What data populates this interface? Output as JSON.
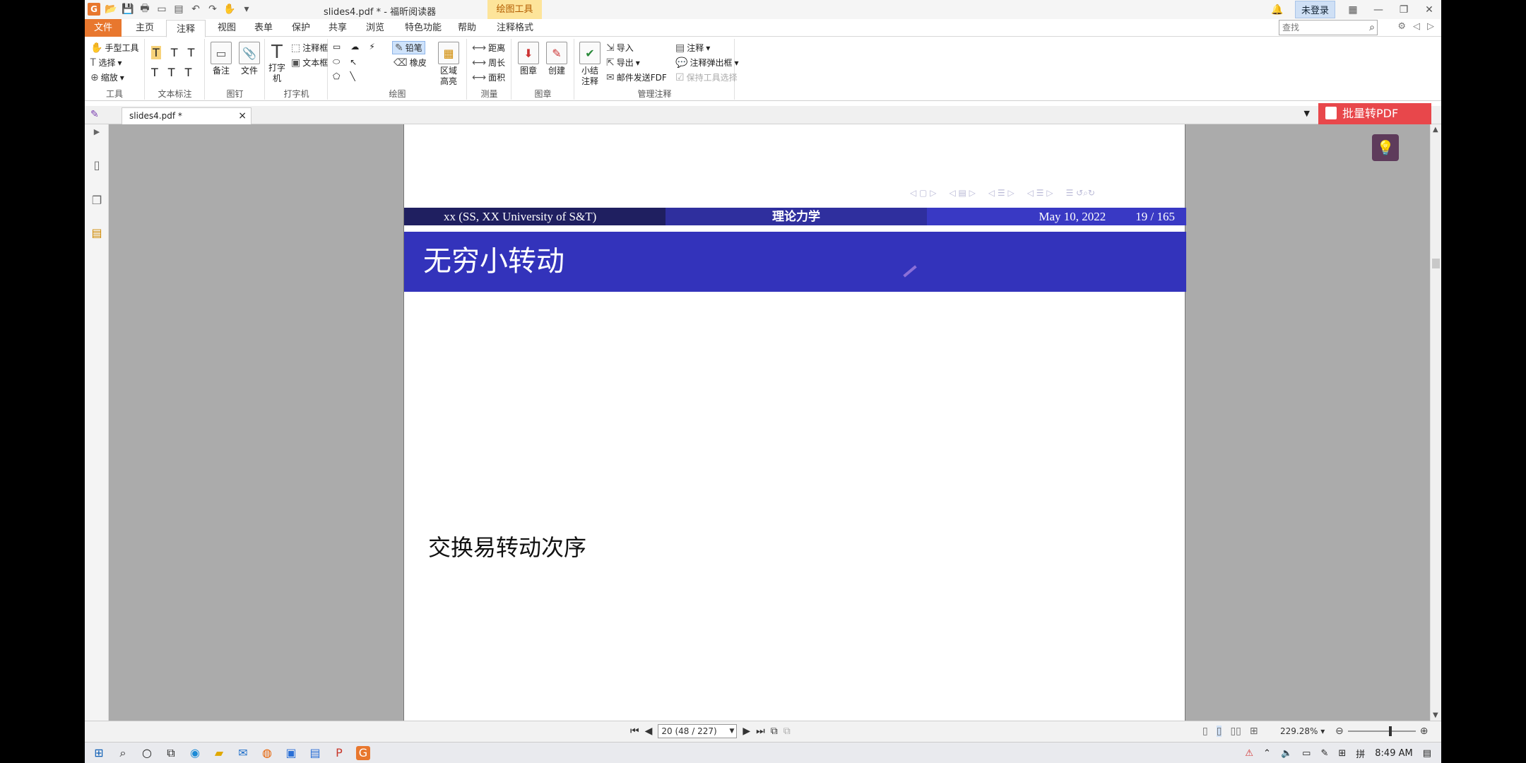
{
  "window": {
    "title": "slides4.pdf * - 福昕阅读器",
    "context_tab": "绘图工具",
    "login": "未登录"
  },
  "tabs": [
    "文件",
    "主页",
    "注释",
    "视图",
    "表单",
    "保护",
    "共享",
    "浏览",
    "特色功能",
    "帮助",
    "注释格式"
  ],
  "search": {
    "placeholder": "查找"
  },
  "ribbon": {
    "tools": {
      "hand": "手型工具",
      "select": "选择",
      "zoom": "缩放",
      "label": "工具"
    },
    "text_markup": {
      "label": "文本标注"
    },
    "pin": {
      "note": "备注",
      "file": "文件",
      "label": "图钉"
    },
    "typewriter": {
      "typewriter": "打字机",
      "callout": "注释框",
      "textbox": "文本框",
      "label": "打字机"
    },
    "drawing": {
      "pencil": "铅笔",
      "eraser": "橡皮",
      "area_highlight": "区域高亮",
      "label": "绘图"
    },
    "measure": {
      "distance": "距离",
      "perimeter": "周长",
      "area": "面积",
      "label": "测量"
    },
    "stamp": {
      "stamp": "图章",
      "create": "创建",
      "label": "图章"
    },
    "manage": {
      "summary": "小结注释",
      "import": "导入",
      "export": "导出",
      "email": "邮件发送FDF",
      "comments": "注释",
      "popup": "注释弹出框",
      "keep_tool": "保持工具选择",
      "label": "管理注释"
    }
  },
  "doc_tab": {
    "name": "slides4.pdf *",
    "batch_label": "批量转PDF"
  },
  "slide": {
    "author": "xx  (SS, XX University of S&T)",
    "course": "理论力学",
    "date": "May 10, 2022",
    "page": "19 / 165",
    "title": "无穷小转动",
    "body": "交换易转动次序"
  },
  "statusbar": {
    "page_field": "20 (48 / 227)",
    "zoom": "229.28%"
  },
  "taskbar": {
    "time": "8:49 AM"
  },
  "colors": {
    "beamer_dark": "#1f1f60",
    "beamer_mid": "#2f2f9e",
    "beamer_light": "#3939c4",
    "title_bg": "#3333bb",
    "accent_orange": "#e8772e",
    "batch_red": "#e8474b"
  }
}
